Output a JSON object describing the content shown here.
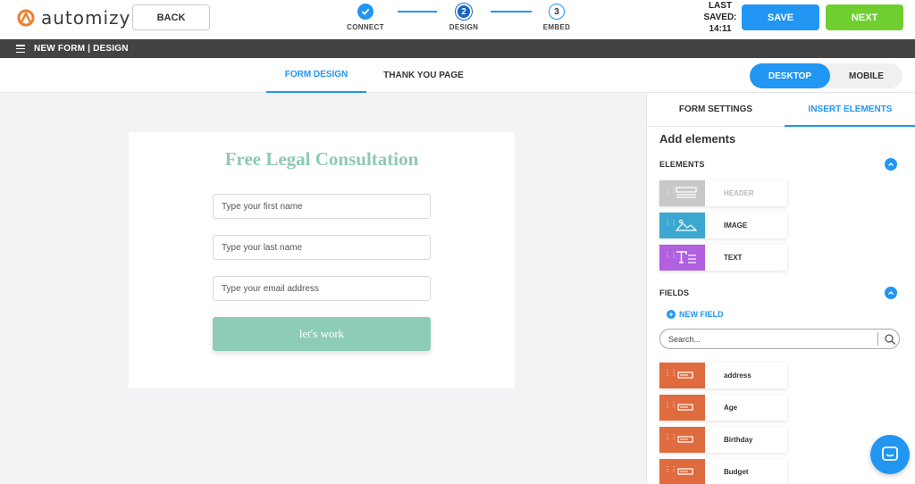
{
  "brand": {
    "name": "automizy",
    "accent": "#f07f2a"
  },
  "header": {
    "back_label": "BACK",
    "steps": [
      {
        "number": "1",
        "label": "CONNECT",
        "state": "done"
      },
      {
        "number": "2",
        "label": "DESIGN",
        "state": "current"
      },
      {
        "number": "3",
        "label": "EMBED",
        "state": "upcoming"
      }
    ],
    "last_saved": {
      "line1": "LAST",
      "line2": "SAVED:",
      "time": "14:11"
    },
    "save_label": "SAVE",
    "next_label": "NEXT"
  },
  "strip": {
    "title": "NEW FORM | DESIGN"
  },
  "tabs": {
    "form_design": "FORM DESIGN",
    "thank_you": "THANK YOU PAGE",
    "active": "form_design"
  },
  "view_toggle": {
    "desktop": "DESKTOP",
    "mobile": "MOBILE",
    "active": "desktop"
  },
  "form": {
    "title": "Free Legal Consultation",
    "title_color": "#8ecab2",
    "fields": [
      {
        "placeholder": "Type your first name"
      },
      {
        "placeholder": "Type your last name"
      },
      {
        "placeholder": "Type your email address"
      }
    ],
    "submit_label": "let's work",
    "submit_color": "#8ecdb5"
  },
  "panel": {
    "tab_settings": "FORM SETTINGS",
    "tab_insert": "INSERT ELEMENTS",
    "active_tab": "insert",
    "add_title": "Add elements",
    "elements_label": "ELEMENTS",
    "elements": [
      {
        "name": "HEADER",
        "icon": "header-icon",
        "color": "#c8c8c8",
        "disabled": true
      },
      {
        "name": "IMAGE",
        "icon": "image-icon",
        "color": "#3aa8d0",
        "disabled": false
      },
      {
        "name": "TEXT",
        "icon": "text-icon",
        "color": "#b060e0",
        "disabled": false
      }
    ],
    "fields_label": "FIELDS",
    "new_field_label": "NEW FIELD",
    "search_placeholder": "Search...",
    "fields": [
      {
        "name": "address"
      },
      {
        "name": "Age"
      },
      {
        "name": "Birthday"
      },
      {
        "name": "Budget"
      }
    ],
    "field_color": "#e06b3f"
  },
  "colors": {
    "primary": "#2196f3",
    "next": "#6fcf2f",
    "strip": "#434343"
  }
}
